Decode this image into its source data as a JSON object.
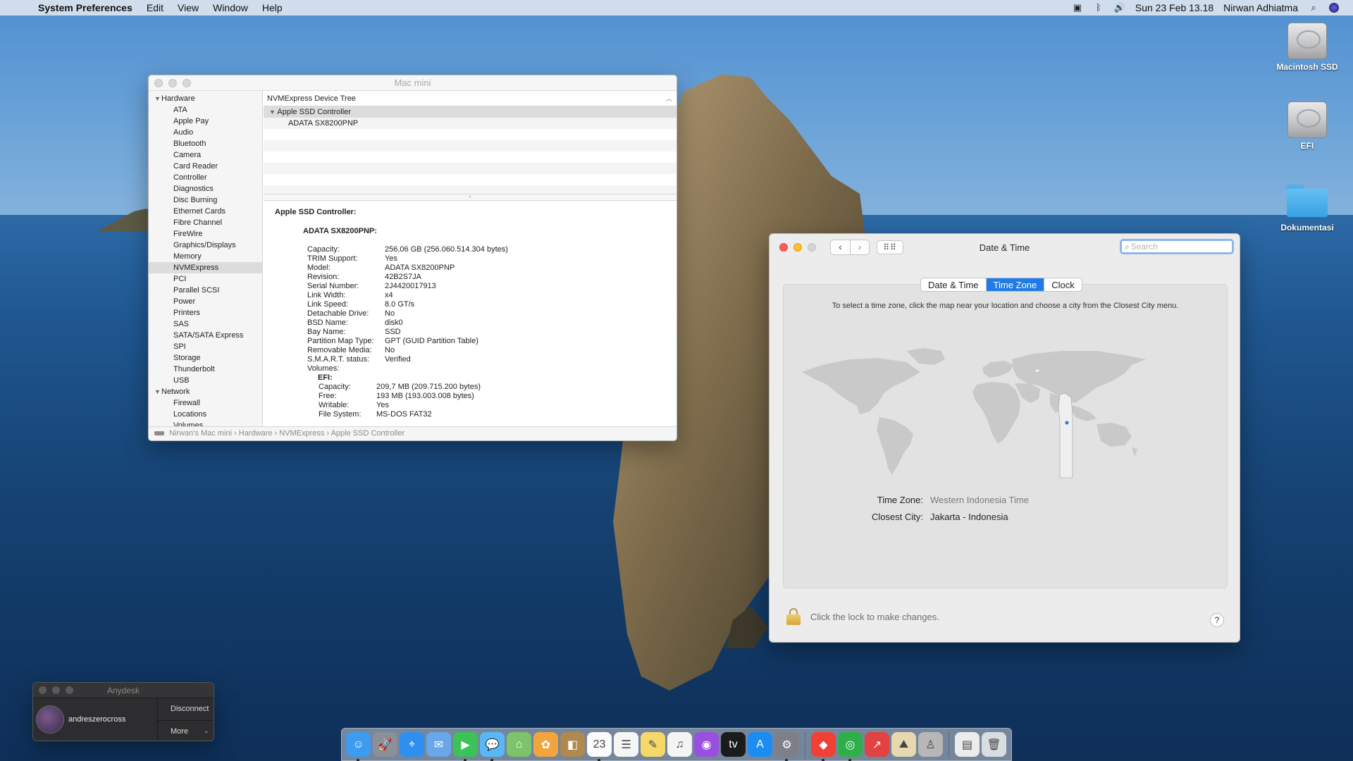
{
  "menubar": {
    "app_name": "System Preferences",
    "menus": [
      "Edit",
      "View",
      "Window",
      "Help"
    ],
    "datetime": "Sun 23 Feb  13.18",
    "user": "Nirwan Adhiatma",
    "status_icons": [
      "display-icon",
      "bluetooth-icon",
      "volume-icon",
      "search-icon",
      "siri-icon"
    ]
  },
  "desktop_icons": [
    {
      "label": "Macintosh SSD",
      "icon": "hard-drive-icon"
    },
    {
      "label": "EFI",
      "icon": "hard-drive-icon"
    },
    {
      "label": "Dokumentasi",
      "icon": "folder-icon"
    }
  ],
  "sysinfo": {
    "title": "Mac mini",
    "sidebar": {
      "hardware_label": "Hardware",
      "hardware_items": [
        "ATA",
        "Apple Pay",
        "Audio",
        "Bluetooth",
        "Camera",
        "Card Reader",
        "Controller",
        "Diagnostics",
        "Disc Burning",
        "Ethernet Cards",
        "Fibre Channel",
        "FireWire",
        "Graphics/Displays",
        "Memory",
        "NVMExpress",
        "PCI",
        "Parallel SCSI",
        "Power",
        "Printers",
        "SAS",
        "SATA/SATA Express",
        "SPI",
        "Storage",
        "Thunderbolt",
        "USB"
      ],
      "selected": "NVMExpress",
      "network_label": "Network",
      "network_items": [
        "Firewall",
        "Locations",
        "Volumes"
      ]
    },
    "tree_header": "NVMExpress Device Tree",
    "controller": "Apple SSD Controller",
    "device": "ADATA SX8200PNP",
    "detail": {
      "title": "Apple SSD Controller:",
      "subtitle": "ADATA SX8200PNP:",
      "fields": [
        {
          "k": "Capacity:",
          "v": "256,06 GB (256.060.514.304 bytes)"
        },
        {
          "k": "TRIM Support:",
          "v": "Yes"
        },
        {
          "k": "Model:",
          "v": "ADATA SX8200PNP"
        },
        {
          "k": "Revision:",
          "v": "42B2S7JA"
        },
        {
          "k": "Serial Number:",
          "v": "2J4420017913"
        },
        {
          "k": "Link Width:",
          "v": "x4"
        },
        {
          "k": "Link Speed:",
          "v": "8.0 GT/s"
        },
        {
          "k": "Detachable Drive:",
          "v": "No"
        },
        {
          "k": "BSD Name:",
          "v": "disk0"
        },
        {
          "k": "Bay Name:",
          "v": "SSD"
        },
        {
          "k": "Partition Map Type:",
          "v": "GPT (GUID Partition Table)"
        },
        {
          "k": "Removable Media:",
          "v": "No"
        },
        {
          "k": "S.M.A.R.T. status:",
          "v": "Verified"
        }
      ],
      "volumes_label": "Volumes:",
      "efi_label": "EFI:",
      "efi_fields": [
        {
          "k": "Capacity:",
          "v": "209,7 MB (209.715.200 bytes)"
        },
        {
          "k": "Free:",
          "v": "193 MB (193.003.008 bytes)"
        },
        {
          "k": "Writable:",
          "v": "Yes"
        },
        {
          "k": "File System:",
          "v": "MS-DOS FAT32"
        }
      ]
    },
    "pathbar": [
      "Nirwan's Mac mini",
      "Hardware",
      "NVMExpress",
      "Apple SSD Controller"
    ]
  },
  "datetime": {
    "title": "Date & Time",
    "search_placeholder": "Search",
    "tabs": [
      "Date & Time",
      "Time Zone",
      "Clock"
    ],
    "active_tab": "Time Zone",
    "instructions": "To select a time zone, click the map near your location and choose a city from the Closest City menu.",
    "time_zone_label": "Time Zone:",
    "time_zone_value": "Western Indonesia Time",
    "closest_city_label": "Closest City:",
    "closest_city_value": "Jakarta - Indonesia",
    "lock_text": "Click the lock to make changes.",
    "help": "?"
  },
  "anydesk": {
    "title": "Anydesk",
    "user": "andreszerocross",
    "disconnect": "Disconnect",
    "more": "More"
  },
  "dock": {
    "apps": [
      {
        "name": "finder-icon",
        "color": "#3d9bf0",
        "glyph": "☺"
      },
      {
        "name": "launchpad-icon",
        "color": "#8a8f98",
        "glyph": "🚀"
      },
      {
        "name": "safari-icon",
        "color": "#2f8ff0",
        "glyph": "⌖"
      },
      {
        "name": "mail-icon",
        "color": "#6aa7e8",
        "glyph": "✉"
      },
      {
        "name": "facetime-icon",
        "color": "#3bc357",
        "glyph": "▶"
      },
      {
        "name": "messages-icon",
        "color": "#5ab7f5",
        "glyph": "💬"
      },
      {
        "name": "maps-icon",
        "color": "#7cc36a",
        "glyph": "⌂"
      },
      {
        "name": "photos-icon",
        "color": "#f3a43c",
        "glyph": "✿"
      },
      {
        "name": "contacts-icon",
        "color": "#b0894f",
        "glyph": "◧"
      },
      {
        "name": "calendar-icon",
        "color": "#fbfbfb",
        "glyph": "23"
      },
      {
        "name": "reminders-icon",
        "color": "#f5f5f5",
        "glyph": "☰"
      },
      {
        "name": "notes-icon",
        "color": "#f5d86a",
        "glyph": "✎"
      },
      {
        "name": "music-icon",
        "color": "#f4f4f4",
        "glyph": "♫"
      },
      {
        "name": "podcasts-icon",
        "color": "#9b4fe0",
        "glyph": "◉"
      },
      {
        "name": "tv-icon",
        "color": "#1b1b1b",
        "glyph": "tv"
      },
      {
        "name": "app-store-icon",
        "color": "#1b8cf2",
        "glyph": "A"
      },
      {
        "name": "system-preferences-icon",
        "color": "#7d8088",
        "glyph": "⚙"
      },
      {
        "name": "anydesk-icon",
        "color": "#ef4136",
        "glyph": "◆"
      },
      {
        "name": "network-radar-icon",
        "color": "#2faf4a",
        "glyph": "◎"
      },
      {
        "name": "teamviewer-icon",
        "color": "#e24242",
        "glyph": "↗"
      },
      {
        "name": "preview-icon",
        "color": "#e6d9b1",
        "glyph": "⛰"
      },
      {
        "name": "automator-icon",
        "color": "#b7b7b7",
        "glyph": "♙"
      },
      {
        "name": "documents-icon",
        "color": "#ececec",
        "glyph": "▤"
      },
      {
        "name": "trash-icon",
        "color": "#d9dde2",
        "glyph": "🗑"
      }
    ]
  }
}
